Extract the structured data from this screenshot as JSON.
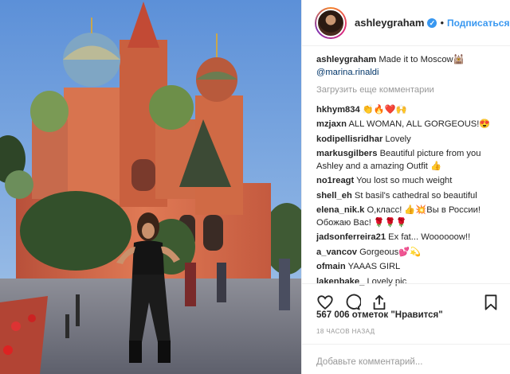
{
  "header": {
    "username": "ashleygraham",
    "separator": "•",
    "follow_label": "Подписаться"
  },
  "caption": {
    "username": "ashleygraham",
    "text": "Made it to Moscow🕍",
    "mention": "@marina.rinaldi"
  },
  "load_more_label": "Загрузить еще комментарии",
  "comments": [
    {
      "username": "hkhym834",
      "text": "👏🔥❤️🙌"
    },
    {
      "username": "mzjaxn",
      "text": "ALL WOMAN, ALL GORGEOUS!😍"
    },
    {
      "username": "kodipellisridhar",
      "text": "Lovely"
    },
    {
      "username": "markusgilbers",
      "text": "Beautiful picture from you Ashley and a amazing Outfit 👍"
    },
    {
      "username": "no1reagt",
      "text": "You lost so much weight"
    },
    {
      "username": "shell_eh",
      "text": "St basil's cathedral so beautiful"
    },
    {
      "username": "elena_nik.k",
      "text": "О,класс! 👍💥Вы в России! Обожаю Вас! 🌹🌹🌹"
    },
    {
      "username": "jadsonferreira21",
      "text": "Ex fat... Woooooow!!"
    },
    {
      "username": "a_vancov",
      "text": "Gorgeous💕💫"
    },
    {
      "username": "ofmain",
      "text": "YAAAS GIRL"
    },
    {
      "username": "lakenbake_",
      "text": "Lovely pic"
    }
  ],
  "likes_text": "567 006 отметок \"Нравится\"",
  "timestamp": "18 ЧАСОВ НАЗАД",
  "add_comment_placeholder": "Добавьте комментарий...",
  "icons": [
    "heart-icon",
    "comment-icon",
    "share-icon",
    "bookmark-icon",
    "verified-icon"
  ],
  "colors": {
    "link": "#3897f0",
    "mention": "#003569",
    "muted": "#999999"
  }
}
